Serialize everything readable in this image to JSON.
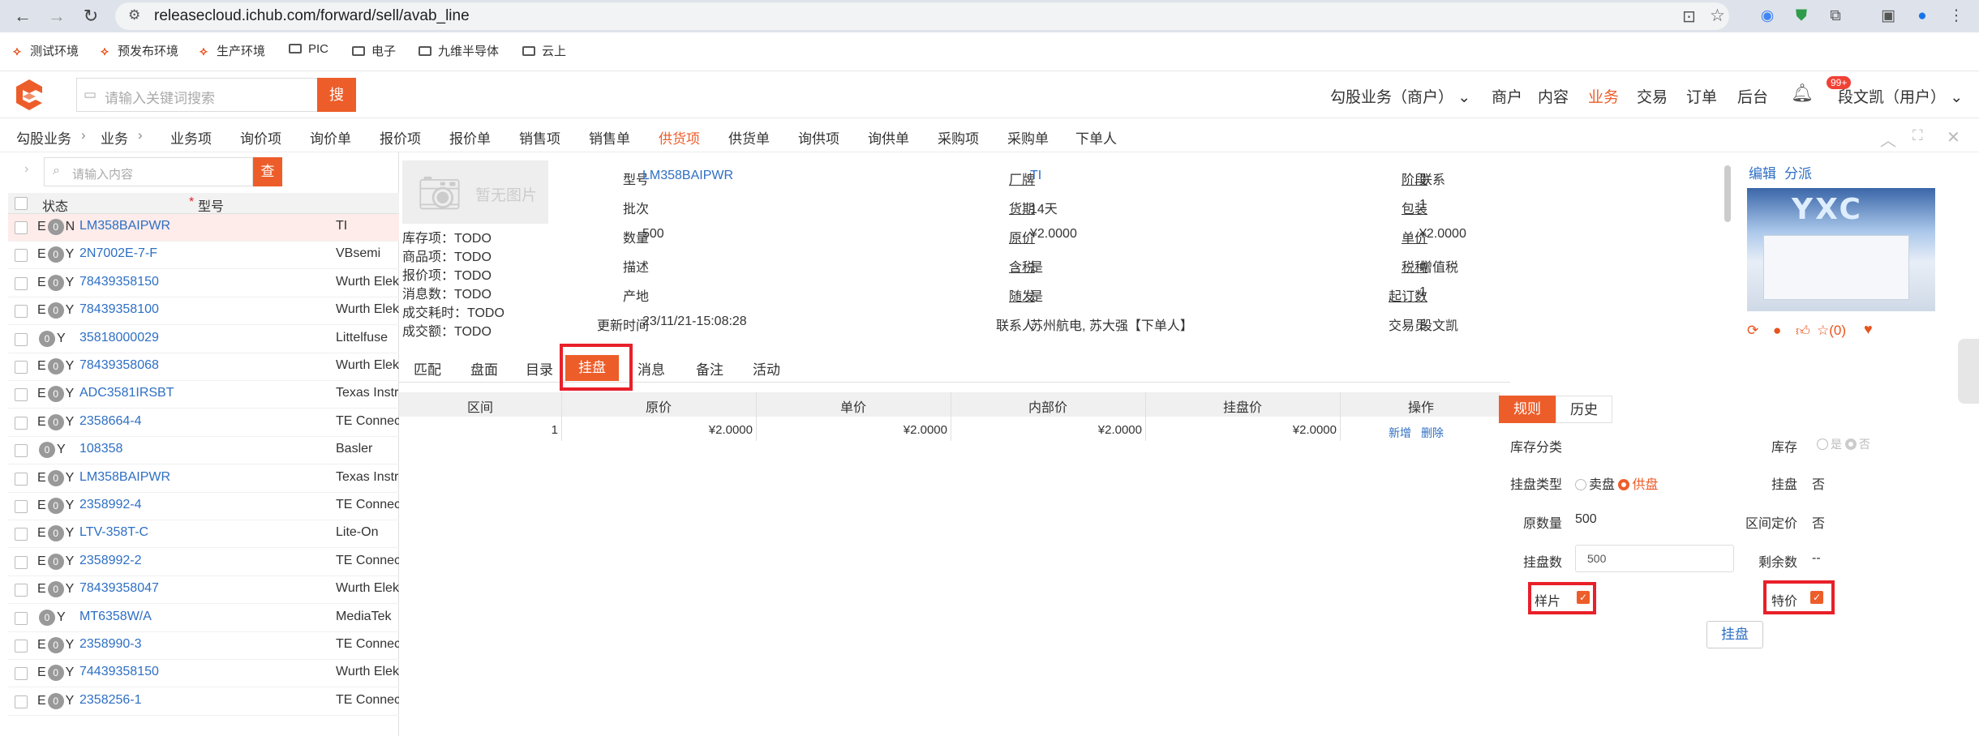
{
  "browser": {
    "url": "releasecloud.ichub.com/forward/sell/avab_line",
    "bookmarks": [
      "测试环境",
      "预发布环境",
      "生产环境",
      "PIC",
      "电子",
      "九维半导体",
      "云上"
    ]
  },
  "header": {
    "search_placeholder": "请输入关键词搜索",
    "search_button": "搜",
    "business_menu": "勾股业务（商户）",
    "nav": [
      "商户",
      "内容",
      "业务",
      "交易",
      "订单",
      "后台"
    ],
    "active_nav": "业务",
    "notifications_badge": "99+",
    "user_menu": "段文凯（用户）"
  },
  "breadcrumbs": [
    "勾股业务",
    "业务",
    "业务项",
    "询价项",
    "询价单",
    "报价项",
    "报价单",
    "销售项",
    "销售单",
    "供货项",
    "供货单",
    "询供项",
    "询供单",
    "采购项",
    "采购单",
    "下单人"
  ],
  "active_crumb": "供货项",
  "left": {
    "search_placeholder": "请输入内容",
    "search_button": "查",
    "col_status": "状态",
    "col_model": "型号",
    "rows": [
      {
        "prefix": "E",
        "badge": "0",
        "suffix": "N",
        "model": "LM358BAIPWR",
        "mfr": "TI"
      },
      {
        "prefix": "E",
        "badge": "0",
        "suffix": "Y",
        "model": "2N7002E-7-F",
        "mfr": "VBsemi"
      },
      {
        "prefix": "E",
        "badge": "0",
        "suffix": "Y",
        "model": "78439358150",
        "mfr": "Wurth Elek"
      },
      {
        "prefix": "E",
        "badge": "0",
        "suffix": "Y",
        "model": "78439358100",
        "mfr": "Wurth Elek"
      },
      {
        "prefix": "",
        "badge": "0",
        "suffix": "Y",
        "model": "35818000029",
        "mfr": "Littelfuse"
      },
      {
        "prefix": "E",
        "badge": "0",
        "suffix": "Y",
        "model": "78439358068",
        "mfr": "Wurth Elek"
      },
      {
        "prefix": "E",
        "badge": "0",
        "suffix": "Y",
        "model": "ADC3581IRSBT",
        "mfr": "Texas Instr"
      },
      {
        "prefix": "E",
        "badge": "0",
        "suffix": "Y",
        "model": "2358664-4",
        "mfr": "TE Connec"
      },
      {
        "prefix": "",
        "badge": "0",
        "suffix": "Y",
        "model": "108358",
        "mfr": "Basler"
      },
      {
        "prefix": "E",
        "badge": "0",
        "suffix": "Y",
        "model": "LM358BAIPWR",
        "mfr": "Texas Instr"
      },
      {
        "prefix": "E",
        "badge": "0",
        "suffix": "Y",
        "model": "2358992-4",
        "mfr": "TE Connec"
      },
      {
        "prefix": "E",
        "badge": "0",
        "suffix": "Y",
        "model": "LTV-358T-C",
        "mfr": "Lite-On"
      },
      {
        "prefix": "E",
        "badge": "0",
        "suffix": "Y",
        "model": "2358992-2",
        "mfr": "TE Connec"
      },
      {
        "prefix": "E",
        "badge": "0",
        "suffix": "Y",
        "model": "78439358047",
        "mfr": "Wurth Elek"
      },
      {
        "prefix": "",
        "badge": "0",
        "suffix": "Y",
        "model": "MT6358W/A",
        "mfr": "MediaTek"
      },
      {
        "prefix": "E",
        "badge": "0",
        "suffix": "Y",
        "model": "2358990-3",
        "mfr": "TE Connec"
      },
      {
        "prefix": "E",
        "badge": "0",
        "suffix": "Y",
        "model": "74439358150",
        "mfr": "Wurth Elek"
      },
      {
        "prefix": "E",
        "badge": "0",
        "suffix": "Y",
        "model": "2358256-1",
        "mfr": "TE Connec"
      }
    ]
  },
  "detail": {
    "no_image": "暂无图片",
    "stats": [
      "库存项：TODO",
      "商品项：TODO",
      "报价项：TODO",
      "消息数：TODO",
      "成交耗时：TODO",
      "成交额：TODO"
    ],
    "col1": [
      {
        "label": "型号",
        "value": "LM358BAIPWR"
      },
      {
        "label": "批次",
        "value": ""
      },
      {
        "label": "数量",
        "value": "500"
      },
      {
        "label": "描述",
        "value": ""
      },
      {
        "label": "产地",
        "value": ""
      },
      {
        "label": "更新时间",
        "value": "23/11/21-15:08:28"
      }
    ],
    "col2": [
      {
        "label": "厂牌",
        "value": "TI"
      },
      {
        "label": "货期",
        "value": "14天"
      },
      {
        "label": "原价",
        "value": "¥2.0000"
      },
      {
        "label": "含税",
        "value": "是"
      },
      {
        "label": "随发",
        "value": "是"
      },
      {
        "label": "联系人",
        "value": "苏州航电, 苏大强【下单人】"
      }
    ],
    "col3": [
      {
        "label": "阶段",
        "value": "联系"
      },
      {
        "label": "包装",
        "value": "1"
      },
      {
        "label": "单价",
        "value": "¥2.0000"
      },
      {
        "label": "税种",
        "value": "增值税"
      },
      {
        "label": "起订数",
        "value": "1"
      },
      {
        "label": "交易员",
        "value": "段文凯"
      }
    ],
    "edit": "编辑",
    "assign": "分派",
    "favorite_count": "☆(0)",
    "product_logo": "YXC"
  },
  "tabs": [
    "匹配",
    "盘面",
    "目录",
    "挂盘",
    "消息",
    "备注",
    "活动"
  ],
  "active_tab": "挂盘",
  "table": {
    "headers": [
      "区间",
      "原价",
      "单价",
      "内部价",
      "挂盘价",
      "操作"
    ],
    "row": {
      "range": "1",
      "orig": "¥2.0000",
      "unit": "¥2.0000",
      "internal": "¥2.0000",
      "listing": "¥2.0000",
      "add": "新增",
      "del": "删除"
    }
  },
  "rules": {
    "tab_rules": "规则",
    "tab_history": "历史",
    "stock_class": "库存分类",
    "stock": "库存",
    "stock_yes": "是",
    "stock_no": "否",
    "listing_type": "挂盘类型",
    "sell": "卖盘",
    "supply": "供盘",
    "listing": "挂盘",
    "listing_val": "否",
    "orig_qty": "原数量",
    "orig_qty_val": "500",
    "range_pricing": "区间定价",
    "range_pricing_val": "否",
    "list_qty": "挂盘数",
    "list_qty_val": "500",
    "remaining": "剩余数",
    "remaining_val": "--",
    "sample": "样片",
    "special": "特价",
    "submit": "挂盘"
  }
}
